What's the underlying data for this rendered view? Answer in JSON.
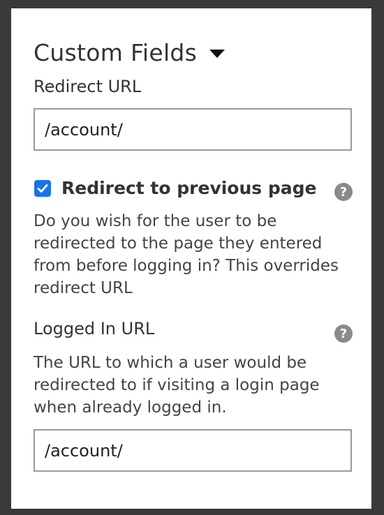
{
  "section": {
    "title": "Custom Fields"
  },
  "redirect_url": {
    "label": "Redirect URL",
    "value": "/account/"
  },
  "redirect_previous": {
    "label": "Redirect to previous page",
    "checked": true,
    "description": "Do you wish for the user to be redirected to the page they entered from before logging in? This overrides redirect URL",
    "help": "?"
  },
  "logged_in_url": {
    "label": "Logged In URL",
    "description": "The URL to which a user would be redirected to if visiting a login page when already logged in.",
    "value": "/account/",
    "help": "?"
  },
  "colors": {
    "background": "#3a3a3a",
    "panel": "#ffffff",
    "checkbox": "#1a73e8",
    "help_icon": "#8a8a8a"
  }
}
